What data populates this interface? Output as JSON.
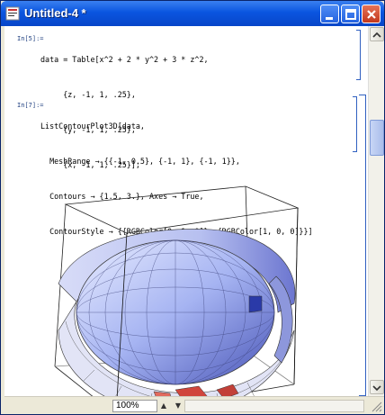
{
  "window": {
    "title": "Untitled-4 *",
    "buttons": [
      "minimize",
      "maximize",
      "close"
    ],
    "accent": "#0a55e0"
  },
  "cells": [
    {
      "label": "In[5]:=",
      "lines": [
        "data = Table[x^2 + 2 * y^2 + 3 * z^2,",
        "     {z, -1, 1, .25},",
        "     {y, -1, 1, .25},",
        "     {x, -1, 1, .25}];"
      ]
    },
    {
      "label": "In[7]:=",
      "lines": [
        "ListContourPlot3D[data,",
        "  MeshRange → {{-1, 0.5}, {-1, 1}, {-1, 1}},",
        "  Contours → {1.5, 3.}, Axes → True,",
        "  ContourStyle → {{RGBColor[0, 1, 0]}, {RGBColor[1, 0, 0]}}]"
      ]
    }
  ],
  "statusbar": {
    "zoom": "100%"
  }
}
